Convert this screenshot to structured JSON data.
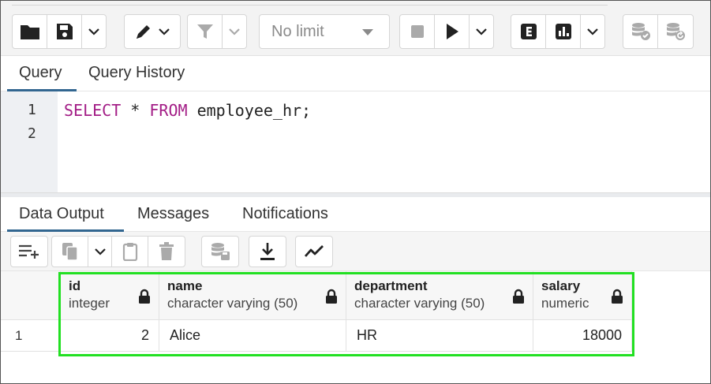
{
  "toolbar": {
    "limit_select": {
      "value": "No limit"
    },
    "icons": [
      "folder-icon",
      "save-icon",
      "chevron-down-icon",
      "edit-pen-icon",
      "filter-icon",
      "stop-icon",
      "play-icon",
      "explain-icon",
      "explain-analyze-icon",
      "commit-icon",
      "rollback-icon"
    ]
  },
  "query_tabs": [
    {
      "label": "Query",
      "active": true
    },
    {
      "label": "Query History",
      "active": false
    }
  ],
  "editor": {
    "line_numbers": [
      "1",
      "2"
    ],
    "code": {
      "kw1": "SELECT",
      "mid": " * ",
      "kw2": "FROM",
      "rest": " employee_hr;"
    }
  },
  "output_tabs": [
    {
      "label": "Data Output",
      "active": true
    },
    {
      "label": "Messages",
      "active": false
    },
    {
      "label": "Notifications",
      "active": false
    }
  ],
  "grid": {
    "columns": [
      {
        "name": "id",
        "type": "integer"
      },
      {
        "name": "name",
        "type": "character varying (50)"
      },
      {
        "name": "department",
        "type": "character varying (50)"
      },
      {
        "name": "salary",
        "type": "numeric"
      }
    ],
    "rows": [
      {
        "row_number": "1",
        "cells": [
          "2",
          "Alice",
          "HR",
          "18000"
        ]
      }
    ]
  },
  "colors": {
    "keyword": "#a31d86",
    "active_tab": "#326690",
    "highlight": "#22e022"
  }
}
